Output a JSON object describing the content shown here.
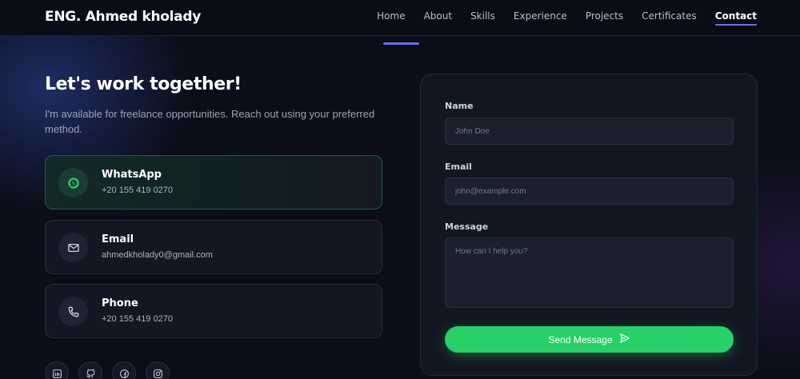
{
  "nav": {
    "brand": "ENG. Ahmed kholady",
    "links": [
      "Home",
      "About",
      "Skills",
      "Experience",
      "Projects",
      "Certificates",
      "Contact"
    ],
    "active": "Contact"
  },
  "contact": {
    "headline": "Let's work together!",
    "subtext": "I'm available for freelance opportunities. Reach out using your preferred method.",
    "cards": [
      {
        "title": "WhatsApp",
        "value": "+20 155 419 0270",
        "icon": "whatsapp-icon"
      },
      {
        "title": "Email",
        "value": "ahmedkholady0@gmail.com",
        "icon": "mail-icon"
      },
      {
        "title": "Phone",
        "value": "+20 155 419 0270",
        "icon": "phone-icon"
      }
    ],
    "social": [
      "linkedin-icon",
      "github-icon",
      "facebook-icon",
      "instagram-icon"
    ]
  },
  "form": {
    "name_label": "Name",
    "name_placeholder": "John Doe",
    "email_label": "Email",
    "email_placeholder": "john@example.com",
    "message_label": "Message",
    "message_placeholder": "How can I help you?",
    "submit_label": "Send Message"
  },
  "colors": {
    "background": "#0b0d18",
    "accent": "#6d72e8",
    "success": "#27d167",
    "whatsapp_border": "#1f5a45"
  }
}
